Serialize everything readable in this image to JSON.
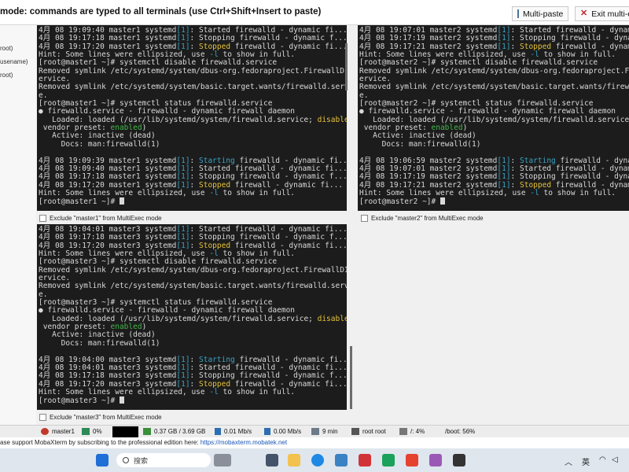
{
  "header": {
    "mode_text": "mode: commands are typed to all terminals (use Ctrl+Shift+Insert to paste)",
    "multipaste_label": "Multi-paste",
    "exit_label": "Exit multi-exe"
  },
  "sidebar": [
    "root)",
    "usename)",
    "root)"
  ],
  "terminals": [
    {
      "name": "master1",
      "lines": [
        [
          [
            "4月 08 19:09:40 master1 systemd",
            ""
          ],
          [
            "[1]",
            "b"
          ],
          [
            ": Started firewalld - dynamic fi...",
            ""
          ]
        ],
        [
          [
            "4月 08 19:17:18 master1 systemd",
            ""
          ],
          [
            "[1]",
            "b"
          ],
          [
            ": Stopping firewalld - dynamic f...",
            ""
          ]
        ],
        [
          [
            "4月 08 19:17:20 master1 systemd",
            ""
          ],
          [
            "[1]",
            "b"
          ],
          [
            ": ",
            ""
          ],
          [
            "Stopped",
            "y"
          ],
          [
            " firewalld - dynamic fi...",
            ""
          ]
        ],
        [
          [
            "Hint: Some lines were ellipsized, use ",
            ""
          ],
          [
            "-l",
            "b"
          ],
          [
            " to show in full.",
            ""
          ]
        ],
        [
          [
            "[root@master1 ~]# systemctl disable firewalld.service",
            ""
          ]
        ],
        [
          [
            "Removed symlink /etc/systemd/system/dbus-org.fedoraproject.FirewallD1.s",
            ""
          ]
        ],
        [
          [
            "ervice.",
            ""
          ]
        ],
        [
          [
            "Removed symlink /etc/systemd/system/basic.target.wants/firewalld.servic",
            ""
          ]
        ],
        [
          [
            "e.",
            ""
          ]
        ],
        [
          [
            "[root@master1 ~]# systemctl status firewalld.service",
            ""
          ]
        ],
        [
          [
            "● firewalld.service - firewalld - dynamic firewall daemon",
            ""
          ]
        ],
        [
          [
            "   Loaded: loaded (/usr/lib/systemd/system/firewalld.service; ",
            ""
          ],
          [
            "disabled",
            "y"
          ],
          [
            ";",
            ""
          ]
        ],
        [
          [
            " vendor preset: ",
            ""
          ],
          [
            "enabled",
            "g"
          ],
          [
            ")",
            ""
          ]
        ],
        [
          [
            "   Active: inactive (dead)",
            ""
          ]
        ],
        [
          [
            "     Docs: man:firewalld(1)",
            ""
          ]
        ],
        [
          [
            "",
            ""
          ]
        ],
        [
          [
            "4月 08 19:09:39 master1 systemd",
            ""
          ],
          [
            "[1]",
            "b"
          ],
          [
            ": ",
            ""
          ],
          [
            "Starting",
            "s"
          ],
          [
            " firewalld - dynamic fi...",
            ""
          ]
        ],
        [
          [
            "4月 08 19:09:40 master1 systemd",
            ""
          ],
          [
            "[1]",
            "b"
          ],
          [
            ": Started firewalld - dynamic fi...",
            ""
          ]
        ],
        [
          [
            "4月 08 19:17:18 master1 systemd",
            ""
          ],
          [
            "[1]",
            "b"
          ],
          [
            ": Stopping firewalld - dynamic f...",
            ""
          ]
        ],
        [
          [
            "4月 08 19:17:20 master1 systemd",
            ""
          ],
          [
            "[1]",
            "b"
          ],
          [
            ": ",
            ""
          ],
          [
            "Stopped",
            "y"
          ],
          [
            " firewall - dynamic fi...",
            ""
          ]
        ],
        [
          [
            "Hint: Some lines were ellipsized, use ",
            ""
          ],
          [
            "-l",
            "b"
          ],
          [
            " to show in full.",
            ""
          ]
        ],
        [
          [
            "[root@master1 ~]# ",
            ""
          ],
          [
            "",
            "cursor"
          ]
        ]
      ],
      "exclude_label": "Exclude \"master1\" from MultiExec mode"
    },
    {
      "name": "master2",
      "lines": [
        [
          [
            "4月 08 19:07:01 master2 systemd",
            ""
          ],
          [
            "[1]",
            "b"
          ],
          [
            ": Started firewalld - dynami",
            ""
          ]
        ],
        [
          [
            "4月 08 19:17:19 master2 systemd",
            ""
          ],
          [
            "[1]",
            "b"
          ],
          [
            ": Stopping firewalld - dynam",
            ""
          ]
        ],
        [
          [
            "4月 08 19:17:21 master2 systemd",
            ""
          ],
          [
            "[1]",
            "b"
          ],
          [
            ": ",
            ""
          ],
          [
            "Stopped",
            "y"
          ],
          [
            " firewalld - dynami",
            ""
          ]
        ],
        [
          [
            "Hint: Some lines were ellipsized, use ",
            ""
          ],
          [
            "-l",
            "b"
          ],
          [
            " to show in full.",
            ""
          ]
        ],
        [
          [
            "[root@master2 ~]# systemctl disable firewalld.service",
            ""
          ]
        ],
        [
          [
            "Removed symlink /etc/systemd/system/dbus-org.fedoraproject.Firewal",
            ""
          ]
        ],
        [
          [
            "ervice.",
            ""
          ]
        ],
        [
          [
            "Removed symlink /etc/systemd/system/basic.target.wants/firewalld.s",
            ""
          ]
        ],
        [
          [
            "e.",
            ""
          ]
        ],
        [
          [
            "[root@master2 ~]# systemctl status firewalld.service",
            ""
          ]
        ],
        [
          [
            "● firewalld.service - firewalld - dynamic firewall daemon",
            ""
          ]
        ],
        [
          [
            "   Loaded: loaded (/usr/lib/systemd/system/firewalld.service; ",
            ""
          ],
          [
            "d",
            "y"
          ]
        ],
        [
          [
            " vendor preset: ",
            ""
          ],
          [
            "enabled",
            "g"
          ],
          [
            ")",
            ""
          ]
        ],
        [
          [
            "   Active: inactive (dead)",
            ""
          ]
        ],
        [
          [
            "     Docs: man:firewalld(1)",
            ""
          ]
        ],
        [
          [
            "",
            ""
          ]
        ],
        [
          [
            "4月 08 19:06:59 master2 systemd",
            ""
          ],
          [
            "[1]",
            "b"
          ],
          [
            ": ",
            ""
          ],
          [
            "Starting",
            "s"
          ],
          [
            " firewalld - dynami",
            ""
          ]
        ],
        [
          [
            "4月 08 19:07:01 master2 systemd",
            ""
          ],
          [
            "[1]",
            "b"
          ],
          [
            ": Started firewalld - dynami",
            ""
          ]
        ],
        [
          [
            "4月 08 19:17:19 master2 systemd",
            ""
          ],
          [
            "[1]",
            "b"
          ],
          [
            ": Stopping firewalld - dynam",
            ""
          ]
        ],
        [
          [
            "4月 08 19:17:21 master2 systemd",
            ""
          ],
          [
            "[1]",
            "b"
          ],
          [
            ": ",
            ""
          ],
          [
            "Stopped",
            "y"
          ],
          [
            " firewalld - dynami",
            ""
          ]
        ],
        [
          [
            "Hint: Some lines were ellipsized, use ",
            ""
          ],
          [
            "-l",
            "b"
          ],
          [
            " to show in full.",
            ""
          ]
        ],
        [
          [
            "[root@master2 ~]# ",
            ""
          ],
          [
            "",
            "cursor"
          ]
        ]
      ],
      "exclude_label": "Exclude \"master2\" from MultiExec mode"
    },
    {
      "name": "master3",
      "lines": [
        [
          [
            "4月 08 19:04:01 master3 systemd",
            ""
          ],
          [
            "[1]",
            "b"
          ],
          [
            ": Started firewalld - dynamic fi...",
            ""
          ]
        ],
        [
          [
            "4月 08 19:17:18 master3 systemd",
            ""
          ],
          [
            "[1]",
            "b"
          ],
          [
            ": Stopping firewalld - dynamic f...",
            ""
          ]
        ],
        [
          [
            "4月 08 19:17:20 master3 systemd",
            ""
          ],
          [
            "[1]",
            "b"
          ],
          [
            ": ",
            ""
          ],
          [
            "Stopped",
            "y"
          ],
          [
            " firewalld - dynamic fi...",
            ""
          ]
        ],
        [
          [
            "Hint: Some lines were ellipsized, use ",
            ""
          ],
          [
            "-l",
            "b"
          ],
          [
            " to show in full.",
            ""
          ]
        ],
        [
          [
            "[root@master3 ~]# systemctl disable firewalld.service",
            ""
          ]
        ],
        [
          [
            "Removed symlink /etc/systemd/system/dbus-org.fedoraproject.FirewallD1.s",
            ""
          ]
        ],
        [
          [
            "ervice.",
            ""
          ]
        ],
        [
          [
            "Removed symlink /etc/systemd/system/basic.target.wants/firewalld.servic",
            ""
          ]
        ],
        [
          [
            "e.",
            ""
          ]
        ],
        [
          [
            "[root@master3 ~]# systemctl status firewalld.service",
            ""
          ]
        ],
        [
          [
            "● firewalld.service - firewalld - dynamic firewall daemon",
            ""
          ]
        ],
        [
          [
            "   Loaded: loaded (/usr/lib/systemd/system/firewalld.service; ",
            ""
          ],
          [
            "disabled",
            "y"
          ],
          [
            ";",
            ""
          ]
        ],
        [
          [
            " vendor preset: ",
            ""
          ],
          [
            "enabled",
            "g"
          ],
          [
            ")",
            ""
          ]
        ],
        [
          [
            "   Active: inactive (dead)",
            ""
          ]
        ],
        [
          [
            "     Docs: man:firewalld(1)",
            ""
          ]
        ],
        [
          [
            "",
            ""
          ]
        ],
        [
          [
            "4月 08 19:04:00 master3 systemd",
            ""
          ],
          [
            "[1]",
            "b"
          ],
          [
            ": ",
            ""
          ],
          [
            "Starting",
            "s"
          ],
          [
            " firewalld - dynamic fi...",
            ""
          ]
        ],
        [
          [
            "4月 08 19:04:01 master3 systemd",
            ""
          ],
          [
            "[1]",
            "b"
          ],
          [
            ": Started firewalld - dynamic fi...",
            ""
          ]
        ],
        [
          [
            "4月 08 19:17:18 master3 systemd",
            ""
          ],
          [
            "[1]",
            "b"
          ],
          [
            ": Stopping firewalld - dynamic f...",
            ""
          ]
        ],
        [
          [
            "4月 08 19:17:20 master3 systemd",
            ""
          ],
          [
            "[1]",
            "b"
          ],
          [
            ": ",
            ""
          ],
          [
            "Stopped",
            "y"
          ],
          [
            " firewalld - dynamic fi...",
            ""
          ]
        ],
        [
          [
            "Hint: Some lines were ellipsized, use ",
            ""
          ],
          [
            "-l",
            "b"
          ],
          [
            " to show in full.",
            ""
          ]
        ],
        [
          [
            "[root@master3 ~]# ",
            ""
          ],
          [
            "",
            "cursor"
          ]
        ]
      ],
      "exclude_label": "Exclude \"master3\" from MultiExec mode"
    }
  ],
  "status": {
    "host": "master1",
    "cpu": "0%",
    "memory": "0.37 GB / 3.69 GB",
    "upload": "0.01 Mb/s",
    "download": "0.00 Mb/s",
    "uptime": "9 min",
    "user": "root  root",
    "root_disk": "/: 4%",
    "boot_disk": "/boot: 56%"
  },
  "notice": {
    "text": "ase support MobaXterm by subscribing to the professional edition here:",
    "link": "https://mobaxterm.mobatek.net"
  },
  "taskbar": {
    "search_placeholder": "搜索",
    "ime": "英"
  },
  "colors": {
    "blue": "#3aa3c4",
    "yellow": "#e6c33a",
    "green": "#43b54a",
    "terminal_bg": "#1c1c1c"
  }
}
